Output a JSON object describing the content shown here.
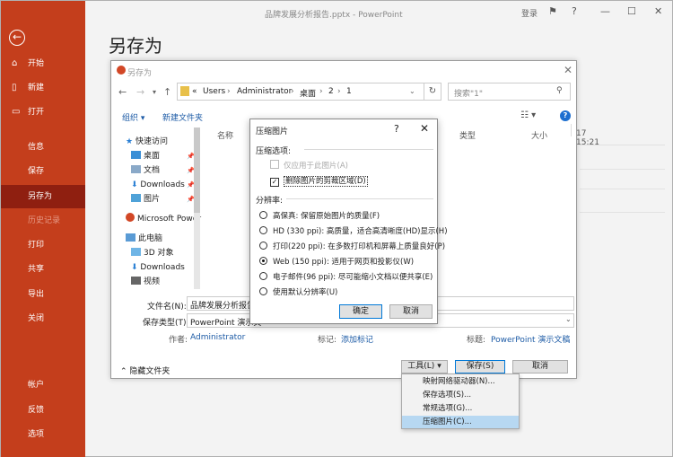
{
  "window": {
    "title": "品牌发展分析报告.pptx  -  PowerPoint",
    "login": "登录"
  },
  "sidebar": {
    "items": [
      {
        "label": "开始",
        "icon": "home-icon"
      },
      {
        "label": "新建",
        "icon": "new-doc-icon"
      },
      {
        "label": "打开",
        "icon": "folder-open-icon"
      },
      {
        "label": "信息"
      },
      {
        "label": "保存"
      },
      {
        "label": "另存为",
        "selected": true
      },
      {
        "label": "历史记录",
        "disabled": true
      },
      {
        "label": "打印"
      },
      {
        "label": "共享"
      },
      {
        "label": "导出"
      },
      {
        "label": "关闭"
      },
      {
        "label": "帐户"
      },
      {
        "label": "反馈"
      },
      {
        "label": "选项"
      }
    ]
  },
  "page": {
    "heading": "另存为"
  },
  "save_dialog": {
    "title": "另存为",
    "path": [
      "«",
      "Users",
      "Administrator",
      "桌面",
      "2",
      "1"
    ],
    "search_placeholder": "搜索\"1\"",
    "organize": "组织",
    "new_folder": "新建文件夹",
    "help": "?",
    "tree": [
      {
        "label": "快速访问",
        "icon": "star-icon"
      },
      {
        "label": "桌面",
        "icon": "desktop-icon",
        "pinned": true
      },
      {
        "label": "文档",
        "icon": "documents-icon",
        "pinned": true
      },
      {
        "label": "Downloads",
        "icon": "download-icon",
        "pinned": true
      },
      {
        "label": "图片",
        "icon": "pictures-icon",
        "pinned": true
      },
      {
        "label": "Microsoft Power",
        "icon": "powerpoint-icon"
      },
      {
        "label": "此电脑",
        "icon": "computer-icon"
      },
      {
        "label": "3D 对象",
        "icon": "3d-objects-icon"
      },
      {
        "label": "Downloads",
        "icon": "download-icon"
      },
      {
        "label": "视频",
        "icon": "video-icon"
      }
    ],
    "columns": {
      "name": "名称",
      "type": "类型",
      "size": "大小",
      "time": "17 15:21"
    },
    "filename_label": "文件名(N):",
    "filename_value": "品牌发展分析报告.p",
    "filetype_label": "保存类型(T):",
    "filetype_value": "PowerPoint 演示文",
    "author_label": "作者:",
    "author_value": "Administrator",
    "tags_label": "标记:",
    "tags_value": "添加标记",
    "title_label": "标题:",
    "title_value": "PowerPoint 演示文稿",
    "hide_folders": "隐藏文件夹",
    "tools_button": "工具(L)",
    "save_button": "保存(S)",
    "cancel_button": "取消"
  },
  "compress_dialog": {
    "title": "压缩图片",
    "help": "?",
    "section_options": "压缩选项:",
    "opt_this_picture": "仅应用于此图片(A)",
    "opt_delete_cropped": "删除图片的剪裁区域(D)",
    "section_resolution": "分辨率:",
    "resolutions": [
      {
        "label": "高保真: 保留原始图片的质量(F)",
        "selected": false
      },
      {
        "label": "HD (330 ppi): 高质量，适合高清晰度(HD)显示(H)",
        "selected": false
      },
      {
        "label": "打印(220 ppi): 在多数打印机和屏幕上质量良好(P)",
        "selected": false
      },
      {
        "label": "Web (150 ppi): 适用于网页和投影仪(W)",
        "selected": true
      },
      {
        "label": "电子邮件(96 ppi): 尽可能缩小文档以便共享(E)",
        "selected": false
      },
      {
        "label": "使用默认分辨率(U)",
        "selected": false
      }
    ],
    "ok": "确定",
    "cancel": "取消"
  },
  "tools_menu": {
    "items": [
      {
        "label": "映射网络驱动器(N)..."
      },
      {
        "label": "保存选项(S)..."
      },
      {
        "label": "常规选项(G)..."
      },
      {
        "label": "压缩图片(C)...",
        "highlighted": true
      }
    ]
  },
  "colors": {
    "accent": "#c43e1c",
    "selected_nav": "#8f1f10",
    "link": "#1d5ba6",
    "menu_highlight": "#b7d8f2"
  }
}
